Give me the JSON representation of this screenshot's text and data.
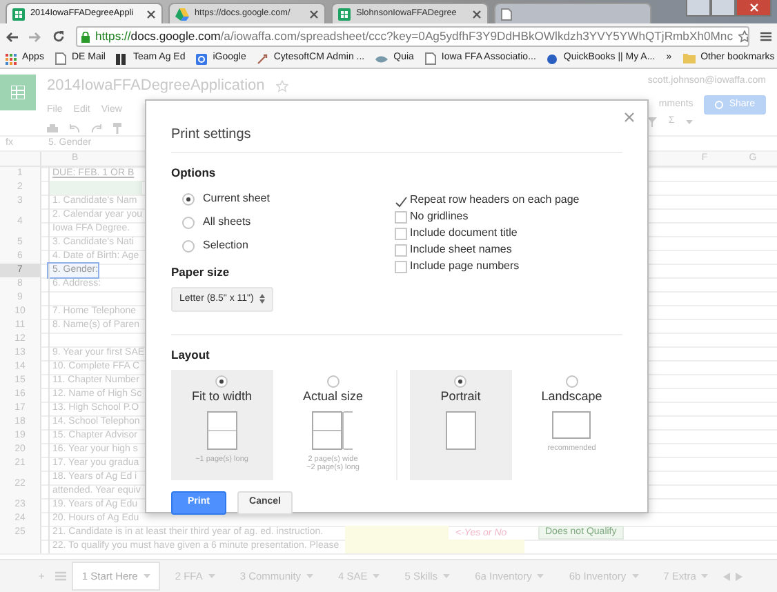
{
  "browser": {
    "tabs": [
      {
        "title": "2014IowaFFADegreeAppli",
        "kind": "sheets",
        "selected": true
      },
      {
        "title": "https://docs.google.com/",
        "kind": "drive",
        "selected": false
      },
      {
        "title": "SlohnsonIowaFFADegree",
        "kind": "sheets",
        "selected": false
      },
      {
        "kind": "page",
        "selected": false
      }
    ],
    "url": {
      "scheme": "https://",
      "host": "docs.google.com",
      "path": "/a/iowaffa.com/spreadsheet/ccc?key=0Ag5ydfhF3Y9DdHBkOWlkdzh3YVY5YWhQTjRmbXh0Mnc"
    },
    "bookmarks": [
      {
        "label": "Apps",
        "kind": "apps"
      },
      {
        "label": "DE Mail",
        "kind": "page"
      },
      {
        "label": "Team Ag Ed",
        "kind": "bars"
      },
      {
        "label": "iGoogle",
        "kind": "google"
      },
      {
        "label": "CytesoftCM Admin ...",
        "kind": "tool"
      },
      {
        "label": "Quia",
        "kind": "quia"
      },
      {
        "label": "Iowa FFA Associatio...",
        "kind": "page"
      },
      {
        "label": "QuickBooks || My A...",
        "kind": "dot"
      }
    ],
    "overflow": "»",
    "other_bookmarks": "Other bookmarks"
  },
  "sheet": {
    "title": "2014IowaFFADegreeApplication",
    "account": "scott.johnson@iowaffa.com",
    "comments": "mments",
    "share": "Share",
    "menu": [
      "File",
      "Edit",
      "View"
    ],
    "sum_symbol": "Σ",
    "formula_label": "fx",
    "formula": "5. Gender",
    "columns": [
      {
        "label": "B",
        "kind": "left"
      },
      {
        "label": "F",
        "kind": "right"
      },
      {
        "label": "G",
        "kind": "right"
      }
    ],
    "rows": [
      {
        "number": "1",
        "lines": [
          "DUE: FEB. 1 OR B"
        ],
        "kind": "heading",
        "selected": false
      },
      {
        "number": "2",
        "lines": [],
        "kind": "filled",
        "selected": false
      },
      {
        "number": "3",
        "lines": [
          "1. Candidate's Nam"
        ],
        "kind": "plain",
        "selected": false
      },
      {
        "number": "4",
        "lines": [
          "2. Calendar year you",
          "Iowa FFA Degree."
        ],
        "kind": "plain",
        "selected": false
      },
      {
        "number": "5",
        "lines": [
          "3. Candidate's Nati"
        ],
        "kind": "plain",
        "selected": false
      },
      {
        "number": "6",
        "lines": [
          "4. Date of Birth: Age"
        ],
        "kind": "plain",
        "selected": false
      },
      {
        "number": "7",
        "lines": [
          "5. Gender:"
        ],
        "kind": "plain",
        "selected": true
      },
      {
        "number": "8",
        "lines": [
          "6. Address:"
        ],
        "kind": "plain",
        "selected": false
      },
      {
        "number": "9",
        "lines": [],
        "kind": "plain",
        "selected": false
      },
      {
        "number": "10",
        "lines": [
          "7. Home Telephone"
        ],
        "kind": "plain",
        "selected": false
      },
      {
        "number": "11",
        "lines": [
          "8. Name(s) of Paren"
        ],
        "kind": "plain",
        "selected": false
      },
      {
        "number": "12",
        "lines": [],
        "kind": "plain",
        "selected": false
      },
      {
        "number": "13",
        "lines": [
          "9. Year your first SAE"
        ],
        "kind": "plain",
        "selected": false
      },
      {
        "number": "14",
        "lines": [
          "10. Complete FFA C"
        ],
        "kind": "plain",
        "selected": false
      },
      {
        "number": "15",
        "lines": [
          "11. Chapter Number"
        ],
        "kind": "plain",
        "selected": false
      },
      {
        "number": "16",
        "lines": [
          "12. Name of High Sc"
        ],
        "kind": "plain",
        "selected": false
      },
      {
        "number": "17",
        "lines": [
          "13. High School P.O"
        ],
        "kind": "plain",
        "selected": false
      },
      {
        "number": "18",
        "lines": [
          "14. School Telephon"
        ],
        "kind": "plain",
        "selected": false
      },
      {
        "number": "19",
        "lines": [
          "15. Chapter Advisor"
        ],
        "kind": "plain",
        "selected": false
      },
      {
        "number": "20",
        "lines": [
          "16. Year your high s"
        ],
        "kind": "plain",
        "selected": false
      },
      {
        "number": "21",
        "lines": [
          "17. Year you gradua"
        ],
        "kind": "plain",
        "selected": false
      },
      {
        "number": "22",
        "lines": [
          "18. Years of Ag Ed i",
          "attended. Year equiv"
        ],
        "kind": "plain",
        "selected": false
      },
      {
        "number": "23",
        "lines": [
          "19. Years of Ag Edu"
        ],
        "kind": "plain",
        "selected": false
      },
      {
        "number": "24",
        "lines": [
          "20. Hours of Ag Edu"
        ],
        "kind": "plain",
        "selected": false
      },
      {
        "number": "25",
        "lines": [
          "21. Candidate is in at least their third year of ag. ed. instruction."
        ],
        "kind": "answer",
        "hint": "<-Yes or No",
        "status": "Does not Qualify",
        "selected": false
      },
      {
        "lines": [
          "22. To qualify you must have given a 6 minute presentation. Please"
        ],
        "kind": "answer",
        "selected": false
      }
    ],
    "sheet_tabs": [
      {
        "label": "1 Start Here",
        "selected": true
      },
      {
        "label": "2 FFA",
        "selected": false
      },
      {
        "label": "3 Community",
        "selected": false
      },
      {
        "label": "4 SAE",
        "selected": false
      },
      {
        "label": "5 Skills",
        "selected": false
      },
      {
        "label": "6a Inventory",
        "selected": false
      },
      {
        "label": "6b Inventory",
        "selected": false
      },
      {
        "label": "7 Extra",
        "selected": false
      }
    ],
    "add_sheet": "+"
  },
  "dialog": {
    "title": "Print settings",
    "options_heading": "Options",
    "print_range": [
      {
        "label": "Current sheet",
        "selected": true
      },
      {
        "label": "All sheets",
        "selected": false
      },
      {
        "label": "Selection",
        "selected": false
      }
    ],
    "checkboxes": [
      {
        "label": "Repeat row headers on each page",
        "checked": true
      },
      {
        "label": "No gridlines",
        "checked": false
      },
      {
        "label": "Include document title",
        "checked": false
      },
      {
        "label": "Include sheet names",
        "checked": false
      },
      {
        "label": "Include page numbers",
        "checked": false
      }
    ],
    "paper_heading": "Paper size",
    "paper_size": "Letter (8.5\" x 11\")",
    "layout_heading": "Layout",
    "scale": [
      {
        "label": "Fit to width",
        "kind": "fit",
        "captions": [
          "~1 page(s) long"
        ],
        "selected": true
      },
      {
        "label": "Actual size",
        "kind": "actual",
        "captions": [
          "2 page(s) wide",
          "~2 page(s) long"
        ],
        "selected": false
      }
    ],
    "orientation": [
      {
        "label": "Portrait",
        "kind": "portrait",
        "selected": true
      },
      {
        "label": "Landscape",
        "kind": "landscape",
        "captions": [
          "recommended"
        ],
        "selected": false
      }
    ],
    "buttons": [
      {
        "label": "Print",
        "kind": "primary"
      },
      {
        "label": "Cancel",
        "kind": "secondary"
      }
    ]
  }
}
